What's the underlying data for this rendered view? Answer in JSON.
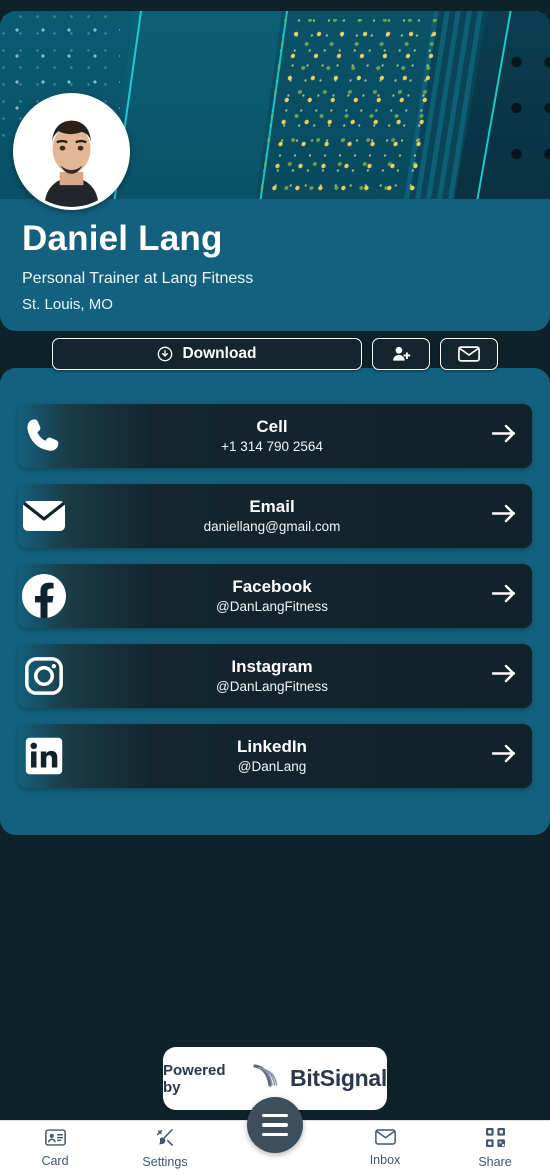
{
  "profile": {
    "name": "Daniel Lang",
    "title": "Personal Trainer at Lang Fitness",
    "location": "St. Louis, MO",
    "avatar_icon": "user-photo"
  },
  "actions": {
    "download_label": "Download",
    "download_icon": "download-circle-icon",
    "add_contact_icon": "user-plus-icon",
    "email_icon": "envelope-icon"
  },
  "links": [
    {
      "icon": "phone-icon",
      "label": "Cell",
      "value": "+1 314 790 2564"
    },
    {
      "icon": "envelope-icon",
      "label": "Email",
      "value": "daniellang@gmail.com"
    },
    {
      "icon": "facebook-icon",
      "label": "Facebook",
      "value": "@DanLangFitness"
    },
    {
      "icon": "instagram-icon",
      "label": "Instagram",
      "value": "@DanLangFitness"
    },
    {
      "icon": "linkedin-icon",
      "label": "LinkedIn",
      "value": "@DanLang"
    }
  ],
  "powered_by": {
    "prefix": "Powered by",
    "brand": "BitSignal",
    "logo_icon": "bitsignal-swoosh-icon"
  },
  "nav": {
    "items": [
      {
        "label": "Card",
        "icon": "id-card-icon"
      },
      {
        "label": "Settings",
        "icon": "brush-wand-icon"
      },
      {
        "label": "Inbox",
        "icon": "envelope-icon"
      },
      {
        "label": "Share",
        "icon": "qr-code-icon"
      }
    ],
    "menu_icon": "hamburger-menu-icon"
  },
  "colors": {
    "teal": "#13607f",
    "dark": "#0e2229",
    "row_dark": "#10222a",
    "fab": "#3d4f5c",
    "accent_cyan": "#1fd6d6",
    "accent_gold": "#f7d85c"
  }
}
